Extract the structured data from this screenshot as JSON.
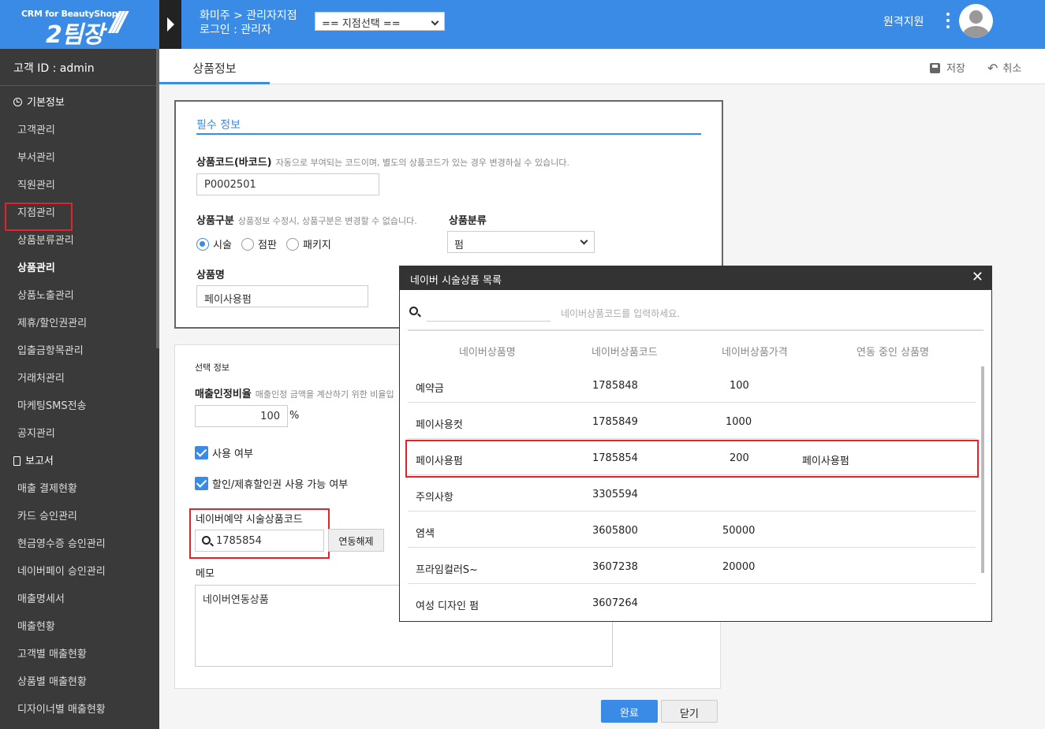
{
  "header": {
    "logo_top": "CRM for BeautyShop",
    "logo_main": "2팀장",
    "branch_path": "화미주 > 관리자지점",
    "login": "로그인 : 관리자",
    "branch_select": "== 지점선택 ==",
    "remote": "원격지원"
  },
  "sidebar": {
    "customer_id": "고객 ID : admin",
    "section_basic": "기본정보",
    "section_report": "보고서",
    "items": [
      "고객관리",
      "부서관리",
      "직원관리",
      "지점관리",
      "상품분류관리",
      "상품관리",
      "상품노출관리",
      "제휴/할인권관리",
      "입출금항목관리",
      "거래처관리",
      "마케팅SMS전송",
      "공지관리"
    ],
    "report_items": [
      "매출 결제현황",
      "카드 승인관리",
      "현금영수증 승인관리",
      "네이버페이 승인관리",
      "매출명세서",
      "매출현황",
      "고객별 매출현황",
      "상품별 매출현황",
      "디자이너별 매출현황"
    ]
  },
  "tabbar": {
    "tab": "상품정보",
    "save": "저장",
    "cancel": "취소"
  },
  "form": {
    "required_title": "필수 정보",
    "code_label": "상품코드(바코드)",
    "code_hint": "자동으로 부여되는 코드이며, 별도의 상품코드가 있는 경우 변경하실 수 있습니다.",
    "code_value": "P0002501",
    "type_label": "상품구분",
    "type_hint": "상품정보 수정시, 상품구분은 변경할 수 없습니다.",
    "type_options": [
      "시술",
      "점판",
      "패키지"
    ],
    "category_label": "상품분류",
    "category_value": "펌",
    "name_label": "상품명",
    "name_value": "페이사용펌",
    "optional_title": "선택 정보",
    "ratio_label": "매출인정비율",
    "ratio_hint": "매출인정 금액을 계산하기 위한 비율입",
    "ratio_value": "100",
    "ratio_unit": "%",
    "use_label": "사용 여부",
    "discount_label": "할인/제휴할인권 사용 가능 여부",
    "naver_label": "네이버예약 시술상품코드",
    "naver_value": "1785854",
    "unlink": "연동해제",
    "memo_label": "메모",
    "memo_value": "네이버연동상품",
    "ok": "완료",
    "close": "닫기"
  },
  "modal": {
    "title": "네이버 시술상품 목록",
    "placeholder": "네이버상품코드를 입력하세요.",
    "columns": [
      "네이버상품명",
      "네이버상품코드",
      "네이버상품가격",
      "연동 중인 상품명"
    ],
    "rows": [
      {
        "name": "예약금",
        "code": "1785848",
        "price": "100",
        "linked": ""
      },
      {
        "name": "페이사용컷",
        "code": "1785849",
        "price": "1000",
        "linked": ""
      },
      {
        "name": "페이사용펌",
        "code": "1785854",
        "price": "200",
        "linked": "페이사용펌"
      },
      {
        "name": "주의사항",
        "code": "3305594",
        "price": "",
        "linked": ""
      },
      {
        "name": "염색",
        "code": "3605800",
        "price": "50000",
        "linked": ""
      },
      {
        "name": "프라임컬러S~",
        "code": "3607238",
        "price": "20000",
        "linked": ""
      },
      {
        "name": "여성 디자인 펌",
        "code": "3607264",
        "price": "",
        "linked": ""
      }
    ]
  },
  "colors": {
    "primary": "#3a8be6",
    "sidebar": "#3a3a3a",
    "highlight": "#e0242a"
  }
}
